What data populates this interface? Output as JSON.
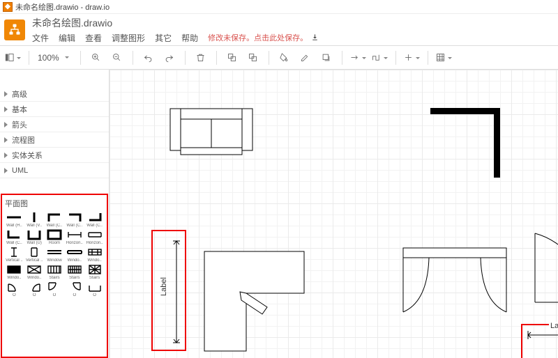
{
  "app": {
    "title": "未命名绘图.drawio - draw.io"
  },
  "header": {
    "filename": "未命名绘图.drawio",
    "menu": {
      "file": "文件",
      "edit": "编辑",
      "view": "查看",
      "adjust": "调整图形",
      "other": "其它",
      "help": "帮助"
    },
    "unsaved": "修改未保存。点击此处保存。"
  },
  "toolbar": {
    "zoom": "100%"
  },
  "sidebar": {
    "cats": {
      "advanced": "高级",
      "basic": "基本",
      "arrow": "箭头",
      "flowchart": "流程图",
      "entity": "实体关系",
      "uml": "UML"
    },
    "palette": {
      "title": "平面图",
      "cells": {
        "c0": "Wall (H..",
        "c1": "Wall (V..",
        "c2": "Wall (C..",
        "c3": "Wall (C..",
        "c4": "Wall (C..",
        "c5": "Wall (C..",
        "c6": "Wall (U)",
        "c7": "Room",
        "c8": "Horizon..",
        "c9": "Horizon..",
        "c10": "Vertical ..",
        "c11": "Vertical ..",
        "c12": "Window",
        "c13": "Windo..",
        "c14": "Windo..",
        "c15": "Windo..",
        "c16": "Windo..",
        "c17": "Stairs",
        "c18": "Stairs",
        "c19": "Stairs",
        "c20": "O",
        "c21": "O",
        "c22": "O",
        "c23": "O",
        "c24": "O"
      }
    }
  },
  "canvas": {
    "dim_label": "Label",
    "dim_label2": "Label"
  }
}
